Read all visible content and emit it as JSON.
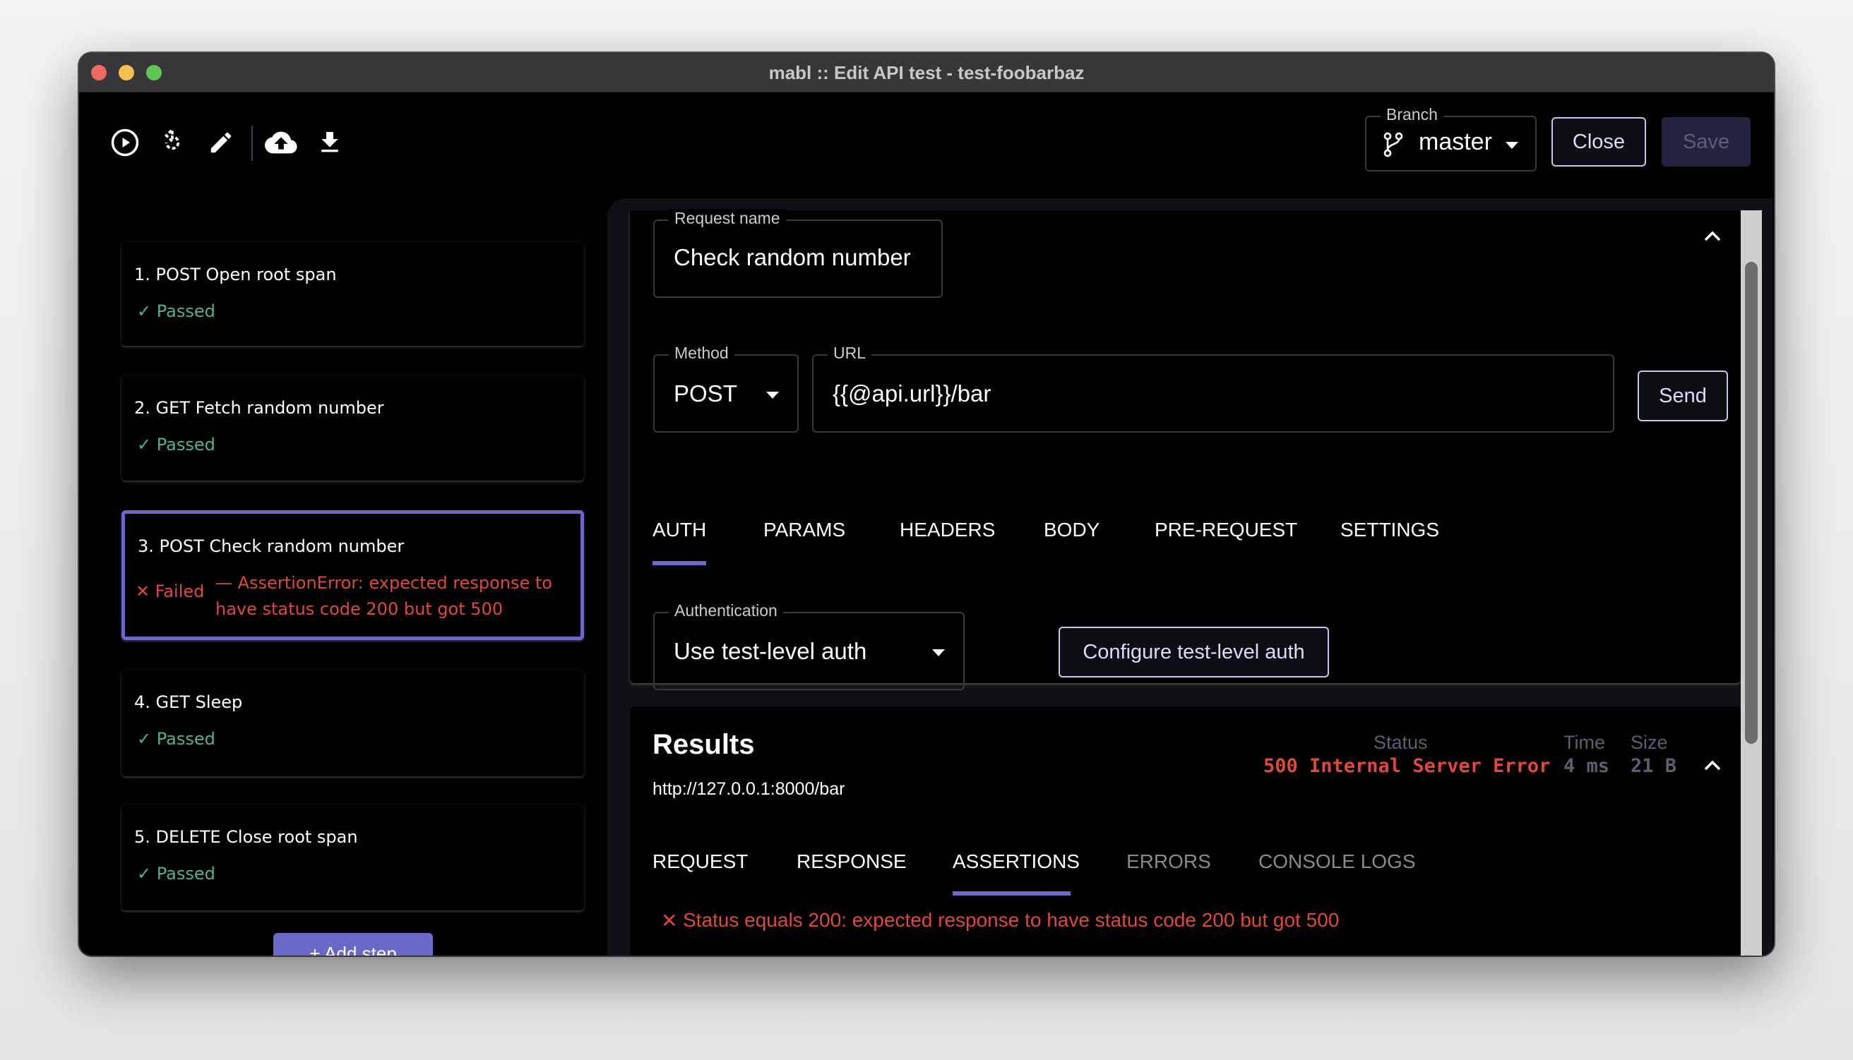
{
  "window": {
    "title": "mabl :: Edit API test - test-foobarbaz"
  },
  "toolbar": {
    "icons": [
      "play-icon",
      "replay-icon",
      "edit-icon",
      "cloud-upload-icon",
      "download-icon"
    ]
  },
  "branch": {
    "label": "Branch",
    "value": "master"
  },
  "actions": {
    "close_label": "Close",
    "save_label": "Save"
  },
  "steps": [
    {
      "title": "1. POST Open root span",
      "status": "Passed"
    },
    {
      "title": "2. GET Fetch random number",
      "status": "Passed"
    },
    {
      "title": "3. POST Check random number",
      "status": "Failed",
      "error": "— AssertionError: expected response to have status code 200 but got 500",
      "selected": true
    },
    {
      "title": "4. GET Sleep",
      "status": "Passed"
    },
    {
      "title": "5. DELETE Close root span",
      "status": "Passed"
    }
  ],
  "add_step_label": "+ Add step",
  "request": {
    "name_label": "Request name",
    "name_value": "Check random number",
    "method_label": "Method",
    "method_value": "POST",
    "url_label": "URL",
    "url_value": "{{@api.url}}/bar",
    "send_label": "Send",
    "tabs": [
      "AUTH",
      "PARAMS",
      "HEADERS",
      "BODY",
      "PRE-REQUEST",
      "SETTINGS"
    ],
    "active_tab": "AUTH",
    "auth_label": "Authentication",
    "auth_value": "Use test-level auth",
    "configure_label": "Configure test-level auth"
  },
  "results": {
    "title": "Results",
    "url": "http://127.0.0.1:8000/bar",
    "status_label": "Status",
    "status_value": "500 Internal Server Error",
    "time_label": "Time",
    "time_value": "4 ms",
    "size_label": "Size",
    "size_value": "21 B",
    "tabs": [
      "REQUEST",
      "RESPONSE",
      "ASSERTIONS",
      "ERRORS",
      "CONSOLE LOGS"
    ],
    "active_tab": "ASSERTIONS",
    "assertion": "Status equals 200: expected response to have status code 200 but got 500"
  },
  "colors": {
    "accent": "#6a68c8",
    "pass": "#4fb38d",
    "fail": "#e0483a",
    "muted": "#5b6070"
  }
}
